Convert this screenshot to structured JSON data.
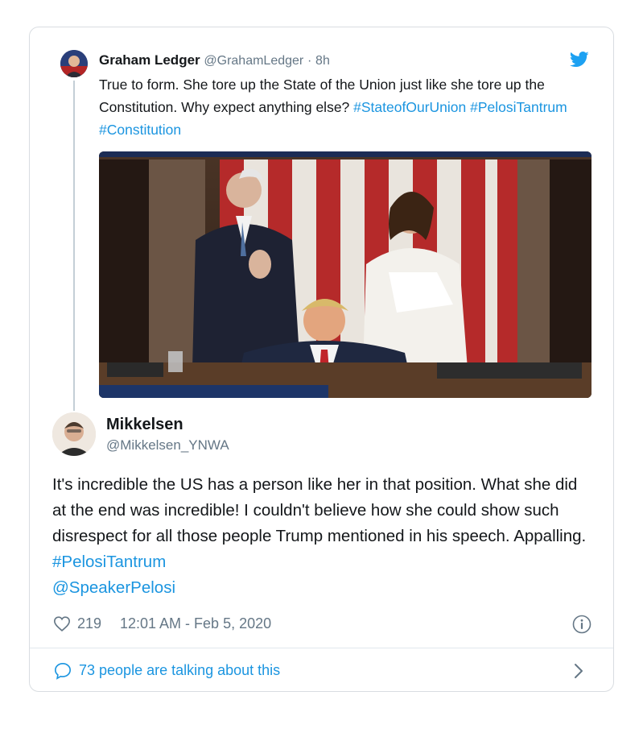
{
  "parent_tweet": {
    "author_name": "Graham Ledger",
    "author_handle": "@GrahamLedger",
    "separator": "·",
    "time_ago": "8h",
    "text_plain": "True to form. She tore up the State of the Union just like she tore up the Constitution. Why expect anything else? ",
    "hashtags": [
      "#StateofOurUnion",
      "#PelosiTantrum",
      "#Constitution"
    ],
    "avatar_icon": "user-avatar",
    "media_icon": "photo",
    "brand_icon": "twitter-bird-icon",
    "brand_color": "#1da1f2"
  },
  "tweet": {
    "author_name": "Mikkelsen",
    "author_handle": "@Mikkelsen_YNWA",
    "text_plain": "It's incredible the US has a person like her in that position. What she did at the end was incredible! I couldn't believe how she could show such disrespect for all those people Trump mentioned in his speech. Appalling. ",
    "hashtag": "#PelosiTantrum",
    "mention": "@SpeakerPelosi",
    "like_count": "219",
    "timestamp": "12:01 AM - Feb 5, 2020",
    "avatar_icon": "user-avatar",
    "info_icon": "info-icon"
  },
  "footer": {
    "talking_label": "73 people are talking about this",
    "chat_icon": "chat-bubble-icon",
    "chevron_icon": "chevron-right-icon"
  },
  "colors": {
    "link": "#1b95e0",
    "text": "#14171a",
    "muted": "#657786",
    "border": "#d9dde1"
  }
}
